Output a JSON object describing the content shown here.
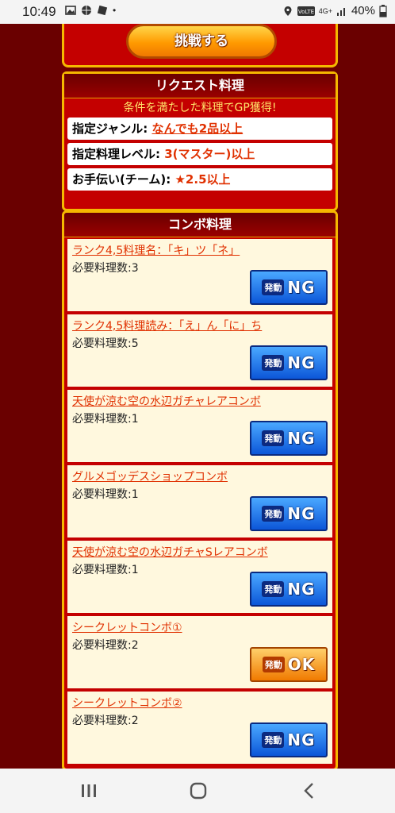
{
  "status": {
    "time": "10:49",
    "network": "4G+",
    "battery": "40%"
  },
  "challenge": {
    "button_label": "挑戦する"
  },
  "request": {
    "title": "リクエスト料理",
    "subtitle": "条件を満たした料理でGP獲得!",
    "rows": [
      {
        "label": "指定ジャンル: ",
        "value": "なんでも2品以上"
      },
      {
        "label": "指定料理レベル: ",
        "value": "3(マスター)以上"
      },
      {
        "label": "お手伝い(チーム): ",
        "value": "★2.5以上"
      }
    ]
  },
  "combo": {
    "title": "コンボ料理",
    "items": [
      {
        "name": "ランク4,5料理名：「キ」ツ「ネ」",
        "required": "必要料理数:3",
        "status": "NG"
      },
      {
        "name": "ランク4,5料理読み：「え」ん「に」ち",
        "required": "必要料理数:5",
        "status": "NG"
      },
      {
        "name": "天使が涼む空の水辺ガチャレアコンボ",
        "required": "必要料理数:1",
        "status": "NG"
      },
      {
        "name": "グルメゴッデスショップコンボ",
        "required": "必要料理数:1",
        "status": "NG"
      },
      {
        "name": "天使が涼む空の水辺ガチャSレアコンボ",
        "required": "必要料理数:1",
        "status": "NG"
      },
      {
        "name": "シークレットコンボ①",
        "required": "必要料理数:2",
        "status": "OK"
      },
      {
        "name": "シークレットコンボ②",
        "required": "必要料理数:2",
        "status": "NG"
      }
    ],
    "badge_prefix": "発動"
  },
  "colors": {
    "panel_red": "#c40000",
    "border_gold": "#f5b800",
    "link_orange": "#e03000",
    "ng_blue": "#0c56d8",
    "ok_orange": "#f07a00"
  },
  "icons": [
    "image-icon",
    "basketball-icon",
    "app-icon",
    "location-icon",
    "volte-icon",
    "signal-icon",
    "battery-icon",
    "recents-icon",
    "home-icon",
    "back-icon"
  ]
}
